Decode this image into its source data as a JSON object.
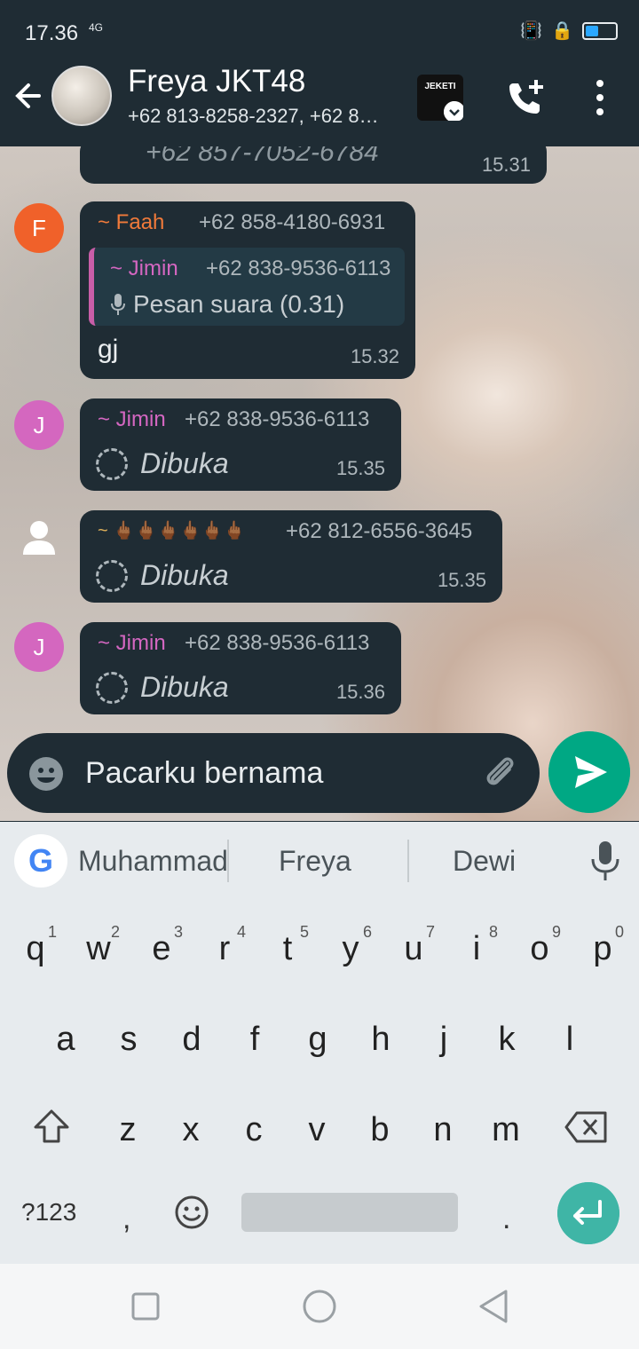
{
  "status": {
    "time": "17.36",
    "network": "4G",
    "battery_level": 0.45
  },
  "header": {
    "title": "Freya JKT48",
    "subtitle": "+62 813-8258-2327, +62 8…",
    "group_thumb_text": "JEKETI"
  },
  "messages": [
    {
      "phone": "+62 857-7052-6784",
      "time": "15.31"
    },
    {
      "avatar_letter": "F",
      "sender": "~ Faah",
      "phone": "+62 858-4180-6931",
      "quote": {
        "sender": "~ Jimin",
        "phone": "+62 838-9536-6113",
        "text": "Pesan suara (0.31)"
      },
      "text": "gj",
      "time": "15.32"
    },
    {
      "avatar_letter": "J",
      "sender": "~ Jimin",
      "phone": "+62 838-9536-6113",
      "text": "Dibuka",
      "time": "15.35"
    },
    {
      "sender": "~ 🖕🏾🖕🏾🖕🏾🖕🏾🖕🏾🖕🏾",
      "phone": "+62 812-6556-3645",
      "text": "Dibuka",
      "time": "15.35"
    },
    {
      "avatar_letter": "J",
      "sender": "~ Jimin",
      "phone": "+62 838-9536-6113",
      "text": "Dibuka",
      "time": "15.36"
    }
  ],
  "colors": {
    "accent": "#00a884",
    "faah": "#f07a3a",
    "jimin": "#d567c2",
    "bubble": "#1f2c34"
  },
  "composer": {
    "value": "Pacarku bernama"
  },
  "suggestions": [
    "Muhammad",
    "Freya",
    "Dewi"
  ],
  "keyboard": {
    "row1": [
      "q",
      "w",
      "e",
      "r",
      "t",
      "y",
      "u",
      "i",
      "o",
      "p"
    ],
    "row1_nums": [
      "1",
      "2",
      "3",
      "4",
      "5",
      "6",
      "7",
      "8",
      "9",
      "0"
    ],
    "row2": [
      "a",
      "s",
      "d",
      "f",
      "g",
      "h",
      "j",
      "k",
      "l"
    ],
    "row3": [
      "z",
      "x",
      "c",
      "v",
      "b",
      "n",
      "m"
    ],
    "symbols_label": "?123",
    "comma": ",",
    "period": "."
  }
}
